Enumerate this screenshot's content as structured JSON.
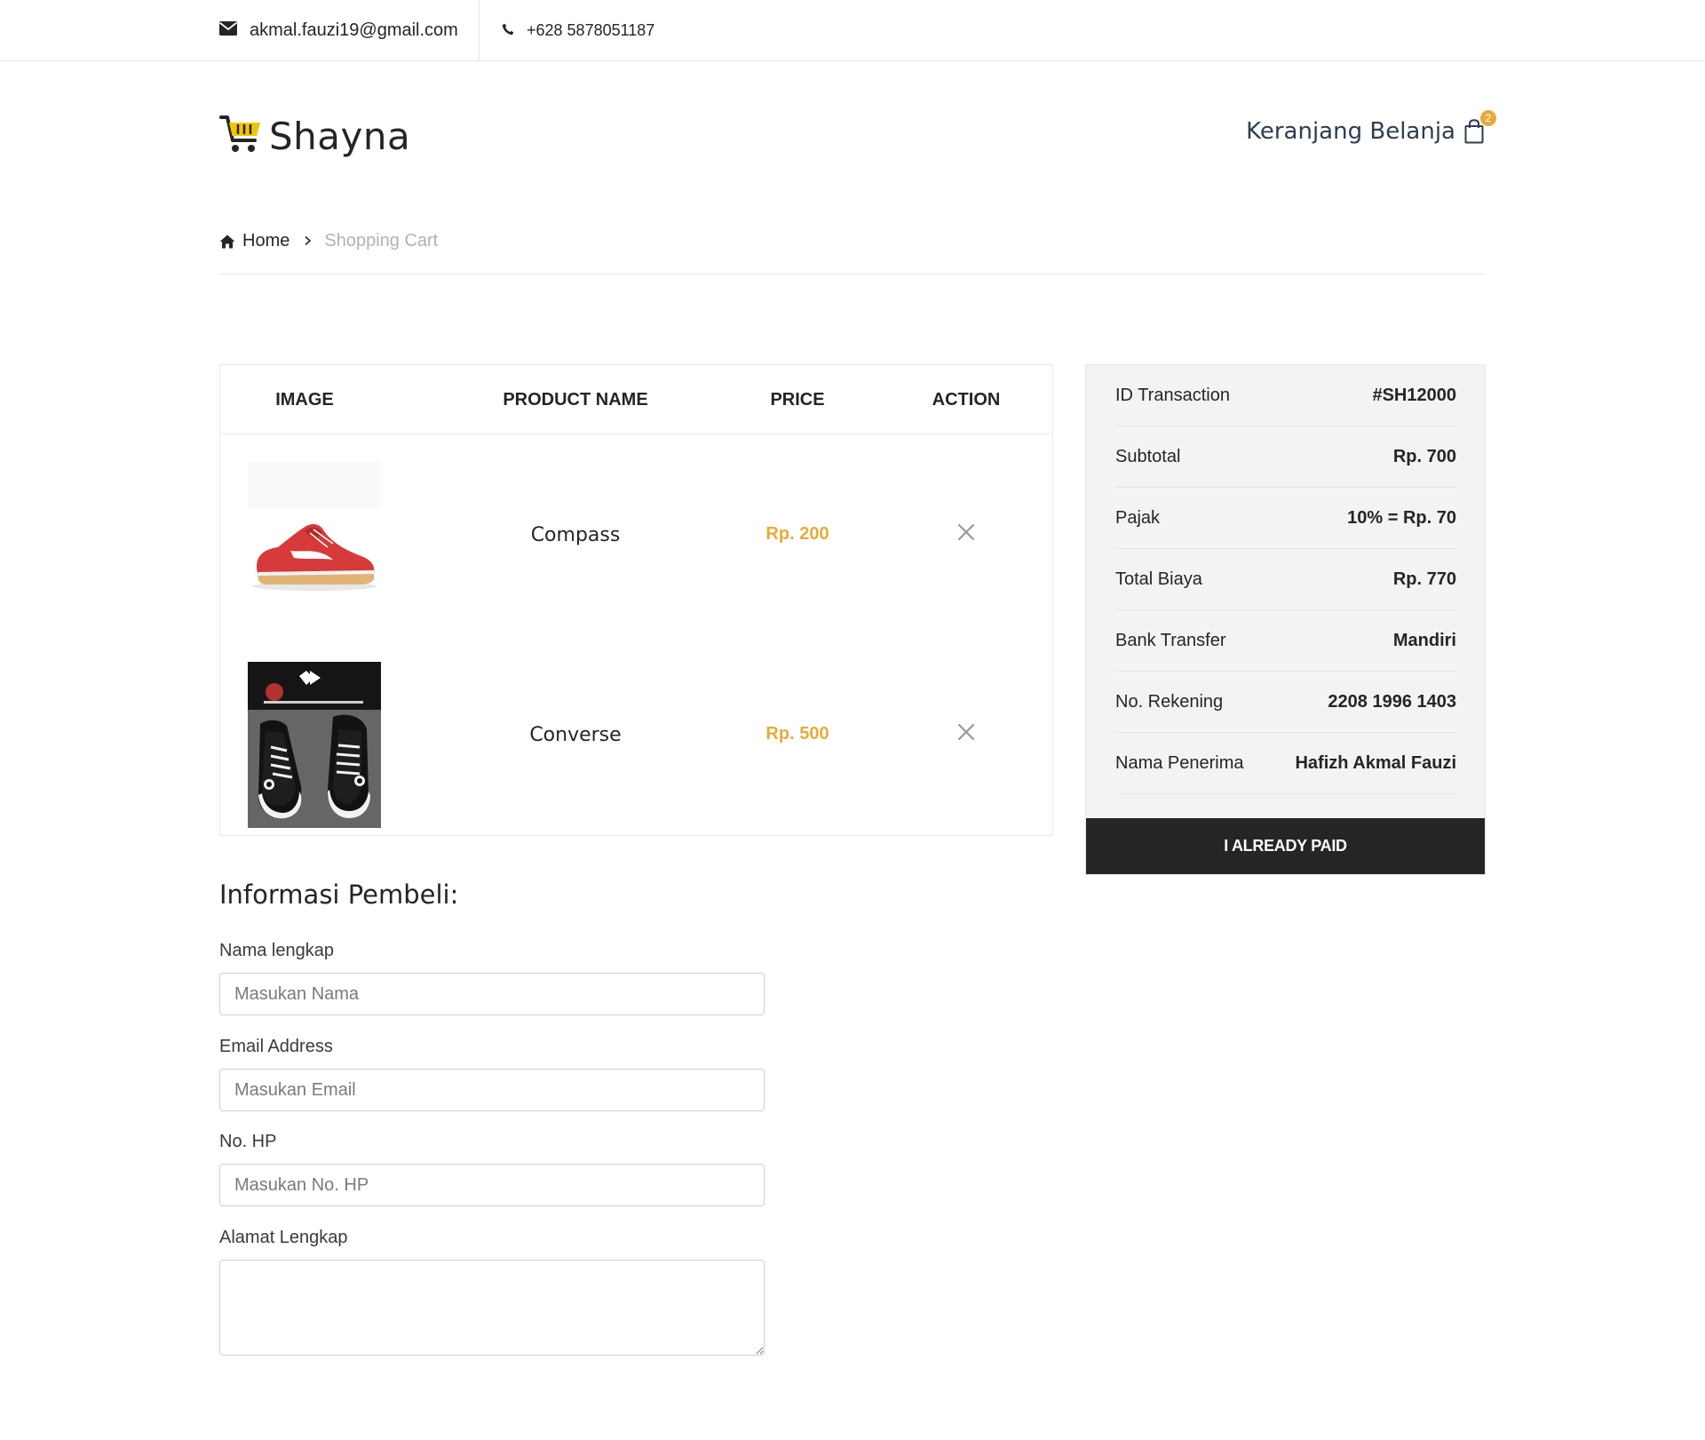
{
  "topbar": {
    "email": "akmal.fauzi19@gmail.com",
    "phone": "+628 5878051187"
  },
  "header": {
    "logo_text": "Shayna",
    "cart_label": "Keranjang Belanja",
    "cart_count": "2"
  },
  "breadcrumb": {
    "home": "Home",
    "current": "Shopping Cart"
  },
  "cart": {
    "headers": {
      "image": "IMAGE",
      "product_name": "PRODUCT NAME",
      "price": "PRICE",
      "action": "ACTION"
    },
    "items": [
      {
        "name": "Compass",
        "price": "Rp. 200",
        "image": "red-sneaker-image",
        "action_icon": "close-icon"
      },
      {
        "name": "Converse",
        "price": "Rp. 500",
        "image": "black-converse-image",
        "action_icon": "close-icon"
      }
    ]
  },
  "summary": {
    "rows": [
      {
        "label": "ID Transaction",
        "value": "#SH12000"
      },
      {
        "label": "Subtotal",
        "value": "Rp. 700"
      },
      {
        "label": "Pajak",
        "value": "10% = Rp. 70"
      },
      {
        "label": "Total Biaya",
        "value": "Rp. 770"
      },
      {
        "label": "Bank Transfer",
        "value": "Mandiri"
      },
      {
        "label": "No. Rekening",
        "value": "2208 1996 1403"
      },
      {
        "label": "Nama Penerima",
        "value": "Hafizh Akmal Fauzi"
      }
    ],
    "button_label": "I ALREADY PAID"
  },
  "form": {
    "title": "Informasi Pembeli:",
    "name_label": "Nama lengkap",
    "name_placeholder": "Masukan Nama",
    "email_label": "Email Address",
    "email_placeholder": "Masukan Email",
    "phone_label": "No. HP",
    "phone_placeholder": "Masukan No. HP",
    "address_label": "Alamat Lengkap",
    "address_value": ""
  },
  "colors": {
    "accent": "#e7ab3c",
    "dark": "#252525",
    "muted": "#b2b2b2",
    "summary_bg": "#f3f3f3"
  }
}
